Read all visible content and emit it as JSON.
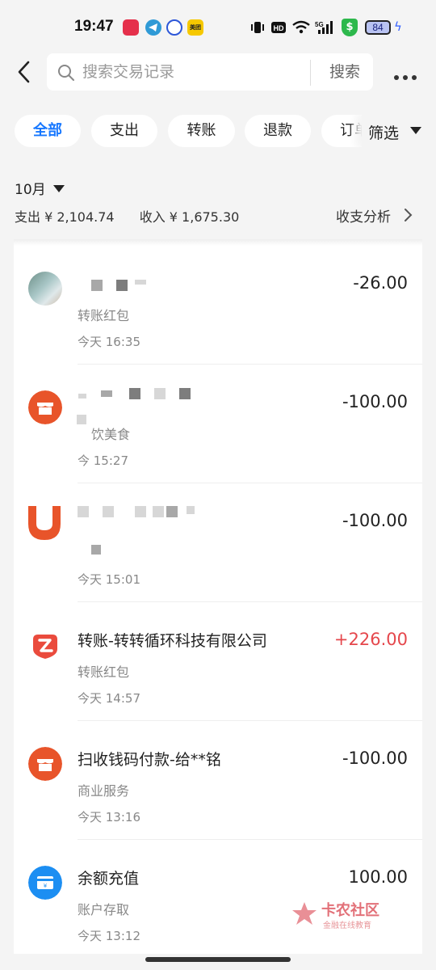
{
  "status_bar": {
    "time": "19:47",
    "battery": "84",
    "app_icons": [
      "music-icon",
      "telegram-icon",
      "baidu-icon",
      "meituan-icon"
    ],
    "meituan_label": "美团",
    "system_icons": [
      "vibrate-icon",
      "hd-icon",
      "wifi-icon",
      "5g-signal-icon",
      "shield-icon",
      "battery-icon",
      "charging-icon"
    ]
  },
  "header": {
    "search_placeholder": "搜索交易记录",
    "search_button": "搜索"
  },
  "tabs": [
    {
      "label": "全部",
      "active": true
    },
    {
      "label": "支出",
      "active": false
    },
    {
      "label": "转账",
      "active": false
    },
    {
      "label": "退款",
      "active": false
    },
    {
      "label": "订单",
      "active": false
    }
  ],
  "filter": {
    "label": "筛选"
  },
  "summary": {
    "month": "10月",
    "expense": "支出 ¥ 2,104.74",
    "income": "收入 ¥ 1,675.30",
    "analysis_link": "收支分析"
  },
  "transactions": [
    {
      "title": "",
      "category": "转账红包",
      "time": "今天 16:35",
      "amount": "-26.00",
      "icon": "avatar-photo"
    },
    {
      "title": "",
      "category": "饮美食",
      "time": "今  15:27",
      "amount": "-100.00",
      "icon": "shop-icon"
    },
    {
      "title": "",
      "category": "",
      "time": "今天 15:01",
      "amount": "-100.00",
      "icon": "magnet-icon"
    },
    {
      "title": "转账-转转循环科技有限公司",
      "category": "转账红包",
      "time": "今天 14:57",
      "amount": "+226.00",
      "icon": "zhuanzhuan-icon"
    },
    {
      "title": "扫收钱码付款-给**铭",
      "category": "商业服务",
      "time": "今天 13:16",
      "amount": "-100.00",
      "icon": "shop-icon"
    },
    {
      "title": "余额充值",
      "category": "账户存取",
      "time": "今天 13:12",
      "amount": "100.00",
      "icon": "recharge-icon"
    }
  ],
  "watermark": {
    "title": "卡农社区",
    "subtitle": "金融在线教育"
  },
  "colors": {
    "accent": "#1677ff",
    "income": "#e5474c",
    "shop": "#e8542a",
    "recharge": "#1c8ef2"
  }
}
